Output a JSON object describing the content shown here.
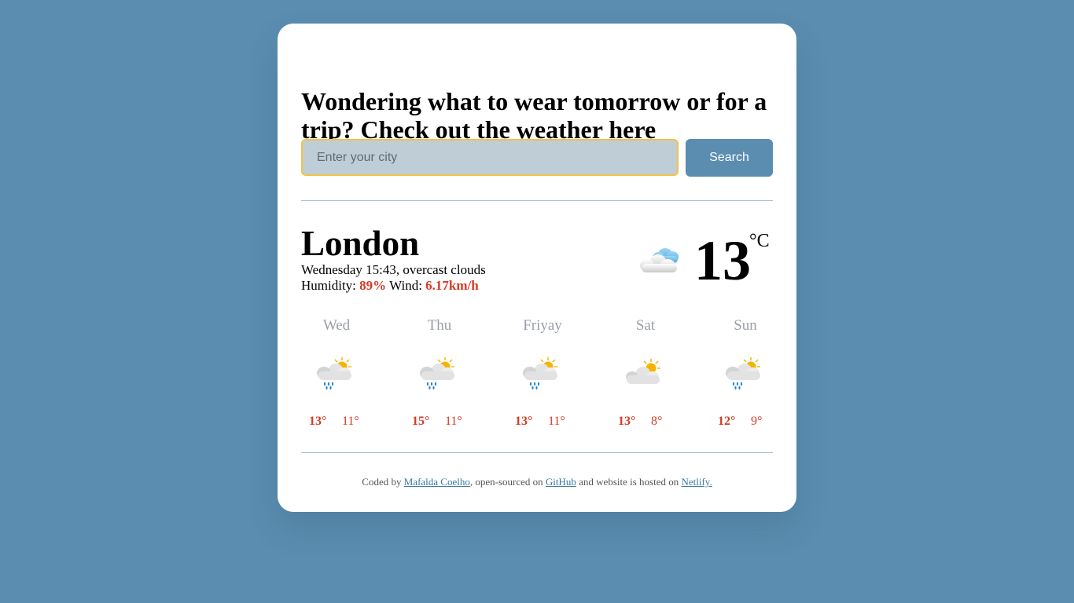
{
  "headline": "Wondering what to wear tomorrow or for a trip? Check out the weather here",
  "search": {
    "placeholder": "Enter your city",
    "value": "",
    "button_label": "Search"
  },
  "current": {
    "city": "London",
    "datetime": "Wednesday 15:43",
    "description": "overcast clouds",
    "humidity_label": "Humidity:",
    "humidity_value": "89%",
    "wind_label": "Wind:",
    "wind_value": "6.17km/h",
    "temperature": "13",
    "unit": "°C",
    "icon": "cloud-icon"
  },
  "forecast": [
    {
      "day": "Wed",
      "icon": "rain-sun-icon",
      "max": "13°",
      "min": "11°"
    },
    {
      "day": "Thu",
      "icon": "rain-sun-icon",
      "max": "15°",
      "min": "11°"
    },
    {
      "day": "Friyay",
      "icon": "rain-sun-icon",
      "max": "13°",
      "min": "11°"
    },
    {
      "day": "Sat",
      "icon": "partly-cloudy-icon",
      "max": "13°",
      "min": "8°"
    },
    {
      "day": "Sun",
      "icon": "rain-sun-icon",
      "max": "12°",
      "min": "9°"
    }
  ],
  "footer": {
    "prefix": "Coded by",
    "author": "Mafalda Coelho",
    "mid1": ", open-sourced on",
    "github": "GitHub",
    "mid2": "and website is hosted on",
    "host": "Netlify."
  },
  "colors": {
    "background": "#5a8db0",
    "accent_red": "#d63a23",
    "input_border": "#f2c24a",
    "input_bg": "#bfcdd6"
  }
}
